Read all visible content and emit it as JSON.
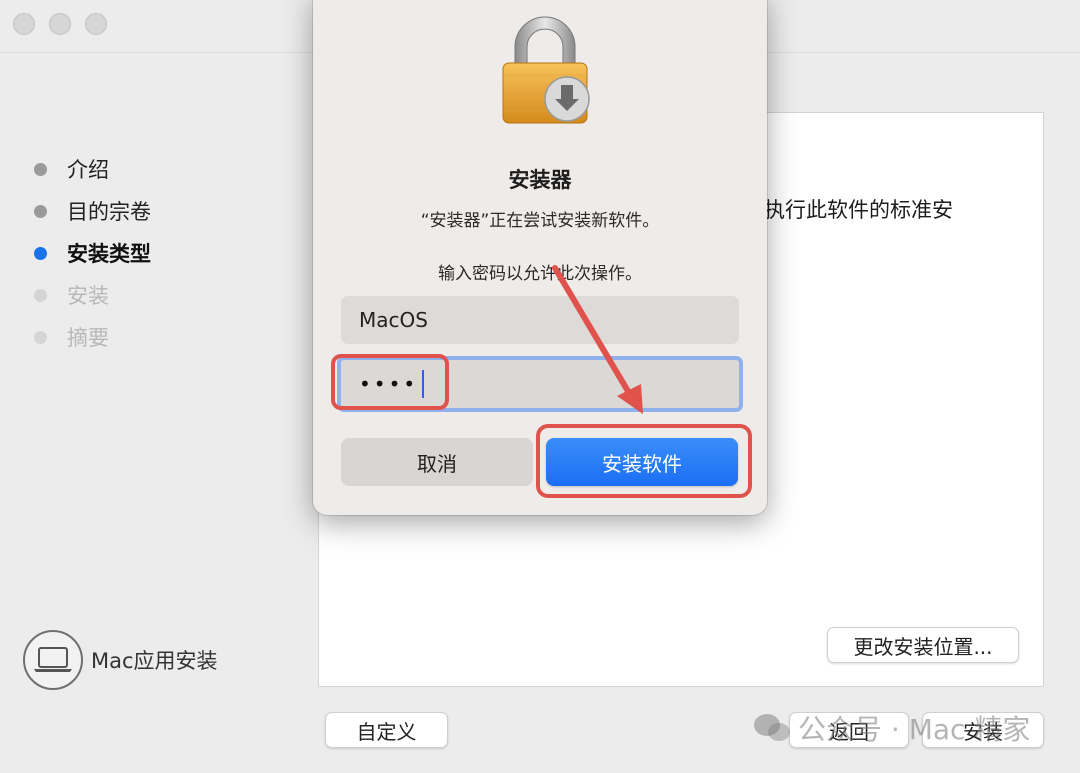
{
  "sidebar": {
    "steps": [
      {
        "label": "介绍",
        "state": "done"
      },
      {
        "label": "目的宗卷",
        "state": "done"
      },
      {
        "label": "安装类型",
        "state": "current"
      },
      {
        "label": "安装",
        "state": "pending"
      },
      {
        "label": "摘要",
        "state": "pending"
      }
    ],
    "brand_label": "Mac应用安装"
  },
  "content": {
    "partial_text": "执行此软件的标准安",
    "change_location_label": "更改安装位置..."
  },
  "footer": {
    "customize_label": "自定义",
    "back_label": "返回",
    "install_label": "安装"
  },
  "dialog": {
    "title": "安装器",
    "message": "“安装器”正在尝试安装新软件。",
    "prompt": "输入密码以允许此次操作。",
    "username": "MacOS",
    "password_mask": "••••",
    "cancel_label": "取消",
    "confirm_label": "安装软件"
  },
  "watermark": {
    "text": "公众号 · Mac 精家"
  },
  "colors": {
    "accent": "#1b6ef3",
    "highlight": "#e0534d",
    "current_step_dot": "#1a73e8"
  }
}
